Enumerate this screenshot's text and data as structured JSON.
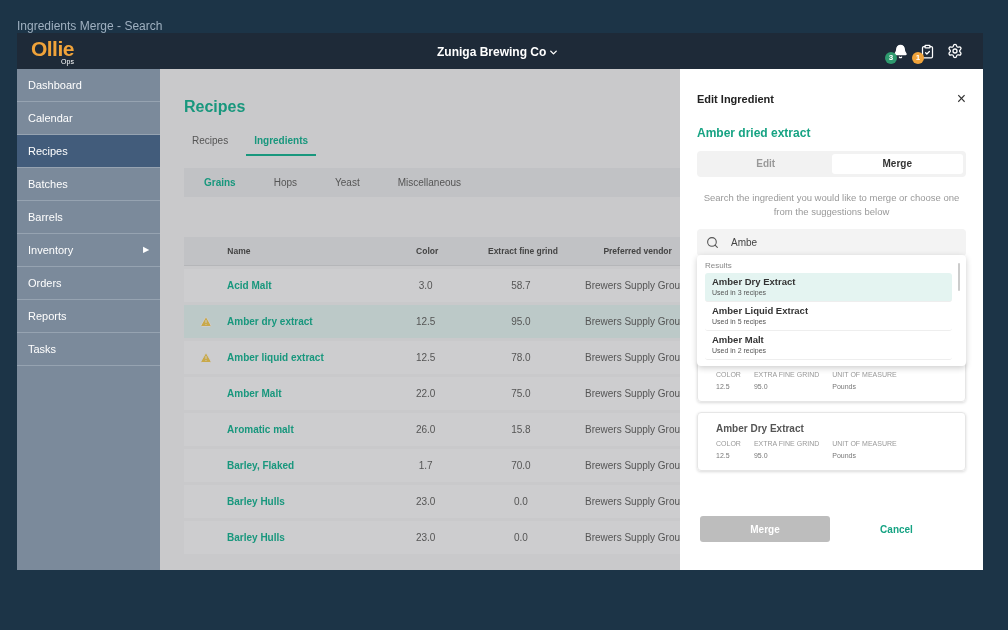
{
  "page_title": "Ingredients Merge - Search",
  "header": {
    "logo": "Ollie",
    "logo_sub": "Ops",
    "company": "Zuniga Brewing Co",
    "notifications": "3",
    "tasks": "1"
  },
  "sidebar": {
    "items": [
      {
        "label": "Dashboard",
        "selected": false
      },
      {
        "label": "Calendar",
        "selected": false
      },
      {
        "label": "Recipes",
        "selected": true
      },
      {
        "label": "Batches",
        "selected": false
      },
      {
        "label": "Barrels",
        "selected": false
      },
      {
        "label": "Inventory",
        "selected": false,
        "arrow": "▶"
      },
      {
        "label": "Orders",
        "selected": false
      },
      {
        "label": "Reports",
        "selected": false
      },
      {
        "label": "Tasks",
        "selected": false
      }
    ]
  },
  "main": {
    "title": "Recipes",
    "tabs": [
      {
        "label": "Recipes",
        "selected": false
      },
      {
        "label": "Ingredients",
        "selected": true
      }
    ],
    "subtabs": [
      {
        "label": "Grains",
        "selected": true
      },
      {
        "label": "Hops",
        "selected": false
      },
      {
        "label": "Yeast",
        "selected": false
      },
      {
        "label": "Miscellaneous",
        "selected": false
      }
    ],
    "table": {
      "columns": [
        "Name",
        "Color",
        "Extract fine grind",
        "Preferred vendor"
      ],
      "rows": [
        {
          "warning": false,
          "selected": false,
          "cells": [
            "Acid Malt",
            "3.0",
            "58.7",
            "Brewers Supply Grou"
          ]
        },
        {
          "warning": true,
          "selected": true,
          "cells": [
            "Amber dry extract",
            "12.5",
            "95.0",
            "Brewers Supply Grou"
          ]
        },
        {
          "warning": true,
          "selected": false,
          "cells": [
            "Amber liquid extract",
            "12.5",
            "78.0",
            "Brewers Supply Grou"
          ]
        },
        {
          "warning": false,
          "selected": false,
          "cells": [
            "Amber Malt",
            "22.0",
            "75.0",
            "Brewers Supply Grou"
          ]
        },
        {
          "warning": false,
          "selected": false,
          "cells": [
            "Aromatic malt",
            "26.0",
            "15.8",
            "Brewers Supply Grou"
          ]
        },
        {
          "warning": false,
          "selected": false,
          "cells": [
            "Barley, Flaked",
            "1.7",
            "70.0",
            "Brewers Supply Grou"
          ]
        },
        {
          "warning": false,
          "selected": false,
          "cells": [
            "Barley Hulls",
            "23.0",
            "0.0",
            "Brewers Supply Grou"
          ]
        },
        {
          "warning": false,
          "selected": false,
          "cells": [
            "Barley Hulls",
            "23.0",
            "0.0",
            "Brewers Supply Grou"
          ]
        }
      ]
    }
  },
  "panel": {
    "title": "Edit Ingredient",
    "close": "×",
    "ingredient": "Amber dried extract",
    "tabs": [
      {
        "label": "Edit",
        "selected": false
      },
      {
        "label": "Merge",
        "selected": true
      }
    ],
    "hint": "Search the ingredient you would like to merge or choose one from the suggestions below",
    "search": {
      "value": "Ambe"
    },
    "results": {
      "heading": "Results",
      "items": [
        {
          "name": "Amber Dry Extract",
          "usage": "Used in 3 recipes",
          "selected": true
        },
        {
          "name": "Amber Liquid Extract",
          "usage": "Used in 5 recipes",
          "selected": false
        },
        {
          "name": "Amber Malt",
          "usage": "Used in 2 recipes",
          "selected": false
        }
      ]
    },
    "suggestions": [
      {
        "fields": [
          {
            "label": "COLOR",
            "value": "12.5"
          },
          {
            "label": "EXTRA FINE GRIND",
            "value": "95.0"
          },
          {
            "label": "UNIT OF MEASURE",
            "value": "Pounds"
          }
        ]
      },
      {
        "name": "Amber Dry Extract",
        "fields": [
          {
            "label": "COLOR",
            "value": "12.5"
          },
          {
            "label": "EXTRA FINE GRIND",
            "value": "95.0"
          },
          {
            "label": "UNIT OF MEASURE",
            "value": "Pounds"
          }
        ]
      }
    ],
    "merge_button": {
      "label": "Merge",
      "disabled": true
    },
    "cancel_button": "Cancel"
  }
}
